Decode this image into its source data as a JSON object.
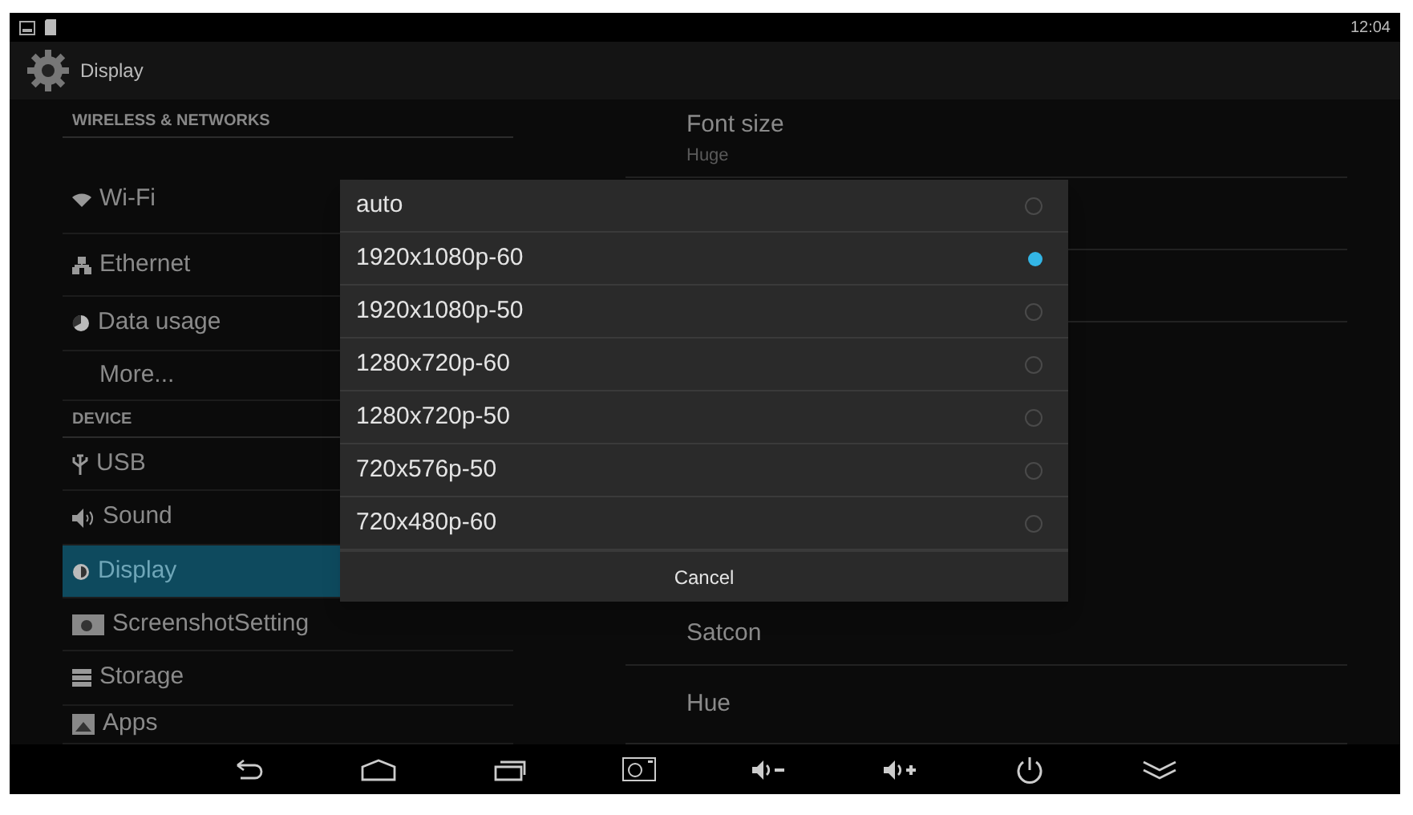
{
  "status_bar": {
    "time": "12:04"
  },
  "action_bar": {
    "title": "Display"
  },
  "sidebar": {
    "items": [
      {
        "kind": "header",
        "label": "WIRELESS & NETWORKS"
      },
      {
        "kind": "item",
        "label": "Wi-Fi",
        "selected": false
      },
      {
        "kind": "item",
        "label": "Ethernet",
        "selected": false
      },
      {
        "kind": "item",
        "label": "Data usage",
        "selected": false
      },
      {
        "kind": "item",
        "label": "More...",
        "selected": false
      },
      {
        "kind": "header",
        "label": "DEVICE"
      },
      {
        "kind": "item",
        "label": "USB",
        "selected": false
      },
      {
        "kind": "item",
        "label": "Sound",
        "selected": false
      },
      {
        "kind": "item",
        "label": "Display",
        "selected": true
      },
      {
        "kind": "item",
        "label": "ScreenshotSetting",
        "selected": false
      },
      {
        "kind": "item",
        "label": "Storage",
        "selected": false
      },
      {
        "kind": "item",
        "label": "Apps",
        "selected": false
      }
    ]
  },
  "settings": [
    {
      "title": "Font size",
      "summary": "Huge"
    },
    {
      "title": "Satcon"
    },
    {
      "title": "Hue"
    }
  ],
  "dialog": {
    "options": [
      {
        "label": "auto",
        "selected": false
      },
      {
        "label": "1920x1080p-60",
        "selected": true
      },
      {
        "label": "1920x1080p-50",
        "selected": false
      },
      {
        "label": "1280x720p-60",
        "selected": false
      },
      {
        "label": "1280x720p-50",
        "selected": false
      },
      {
        "label": "720x576p-50",
        "selected": false
      },
      {
        "label": "720x480p-60",
        "selected": false
      }
    ],
    "cancel": "Cancel"
  }
}
